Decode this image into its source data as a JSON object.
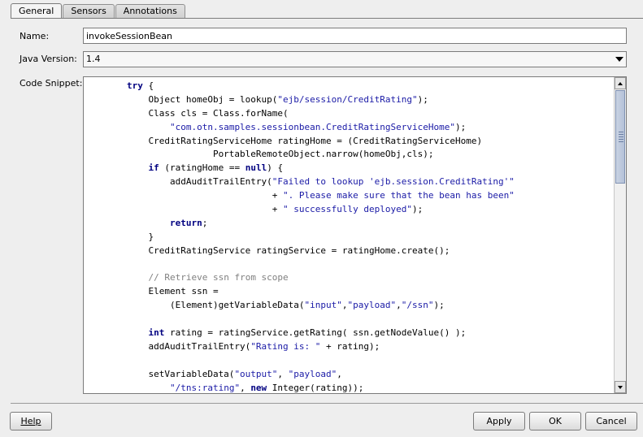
{
  "tabs": [
    {
      "label": "General",
      "active": true
    },
    {
      "label": "Sensors",
      "active": false
    },
    {
      "label": "Annotations",
      "active": false
    }
  ],
  "form": {
    "name_label": "Name:",
    "name_value": "invokeSessionBean",
    "java_version_label": "Java Version:",
    "java_version_value": "1.4",
    "code_snippet_label": "Code Snippet:"
  },
  "code_lines": [
    [
      {
        "t": "        "
      },
      {
        "t": "try",
        "c": "kw"
      },
      {
        "t": " {"
      }
    ],
    [
      {
        "t": "            Object homeObj = lookup("
      },
      {
        "t": "\"ejb/session/CreditRating\"",
        "c": "str"
      },
      {
        "t": ");"
      }
    ],
    [
      {
        "t": "            Class cls = Class.forName("
      }
    ],
    [
      {
        "t": "                "
      },
      {
        "t": "\"com.otn.samples.sessionbean.CreditRatingServiceHome\"",
        "c": "str"
      },
      {
        "t": ");"
      }
    ],
    [
      {
        "t": "            CreditRatingServiceHome ratingHome = (CreditRatingServiceHome)"
      }
    ],
    [
      {
        "t": "                        PortableRemoteObject.narrow(homeObj,cls);"
      }
    ],
    [
      {
        "t": "            "
      },
      {
        "t": "if",
        "c": "kw"
      },
      {
        "t": " (ratingHome == "
      },
      {
        "t": "null",
        "c": "kw"
      },
      {
        "t": ") {"
      }
    ],
    [
      {
        "t": "                addAuditTrailEntry("
      },
      {
        "t": "\"Failed to lookup 'ejb.session.CreditRating'\"",
        "c": "str"
      }
    ],
    [
      {
        "t": "                                   + "
      },
      {
        "t": "\". Please make sure that the bean has been\"",
        "c": "str"
      }
    ],
    [
      {
        "t": "                                   + "
      },
      {
        "t": "\" successfully deployed\"",
        "c": "str"
      },
      {
        "t": ");"
      }
    ],
    [
      {
        "t": "                "
      },
      {
        "t": "return",
        "c": "kw"
      },
      {
        "t": ";"
      }
    ],
    [
      {
        "t": "            }"
      }
    ],
    [
      {
        "t": "            CreditRatingService ratingService = ratingHome.create();"
      }
    ],
    [
      {
        "t": ""
      }
    ],
    [
      {
        "t": "            "
      },
      {
        "t": "// Retrieve ssn from scope",
        "c": "cm"
      }
    ],
    [
      {
        "t": "            Element ssn ="
      }
    ],
    [
      {
        "t": "                (Element)getVariableData("
      },
      {
        "t": "\"input\"",
        "c": "str"
      },
      {
        "t": ","
      },
      {
        "t": "\"payload\"",
        "c": "str"
      },
      {
        "t": ","
      },
      {
        "t": "\"/ssn\"",
        "c": "str"
      },
      {
        "t": ");"
      }
    ],
    [
      {
        "t": ""
      }
    ],
    [
      {
        "t": "            "
      },
      {
        "t": "int",
        "c": "kw"
      },
      {
        "t": " rating = ratingService.getRating( ssn.getNodeValue() );"
      }
    ],
    [
      {
        "t": "            addAuditTrailEntry("
      },
      {
        "t": "\"Rating is: \"",
        "c": "str"
      },
      {
        "t": " + rating);"
      }
    ],
    [
      {
        "t": ""
      }
    ],
    [
      {
        "t": "            setVariableData("
      },
      {
        "t": "\"output\"",
        "c": "str"
      },
      {
        "t": ", "
      },
      {
        "t": "\"payload\"",
        "c": "str"
      },
      {
        "t": ","
      }
    ],
    [
      {
        "t": "                "
      },
      {
        "t": "\"/tns:rating\"",
        "c": "str"
      },
      {
        "t": ", "
      },
      {
        "t": "new",
        "c": "kw"
      },
      {
        "t": " Integer(rating));"
      }
    ]
  ],
  "buttons": {
    "help": "Help",
    "apply": "Apply",
    "ok": "OK",
    "cancel": "Cancel"
  },
  "colors": {
    "keyword": "#000080",
    "string": "#1a1aa6",
    "comment": "#808080"
  }
}
